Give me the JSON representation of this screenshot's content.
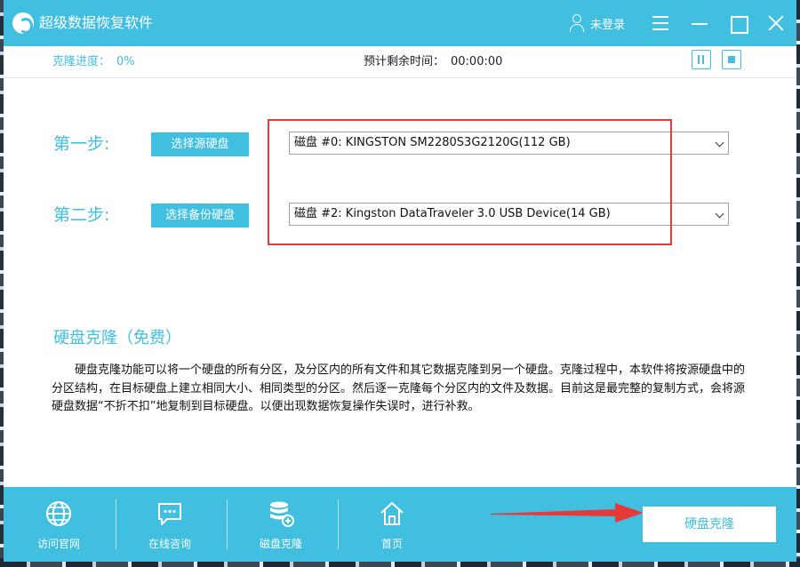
{
  "app": {
    "title": "超级数据恢复软件"
  },
  "titlebar": {
    "user_label": "未登录"
  },
  "progress": {
    "label": "克隆进度：",
    "value": "0%",
    "eta_label": "预计剩余时间：",
    "eta_value": "00:00:00"
  },
  "steps": [
    {
      "label": "第一步:",
      "button": "选择源硬盘",
      "selected": "磁盘 #0: KINGSTON SM2280S3G2120G(112 GB)"
    },
    {
      "label": "第二步:",
      "button": "选择备份硬盘",
      "selected": "磁盘 #2: Kingston DataTraveler 3.0 USB Device(14 GB)"
    }
  ],
  "info": {
    "title": "硬盘克隆（免费）",
    "text": "硬盘克隆功能可以将一个硬盘的所有分区，及分区内的所有文件和其它数据克隆到另一个硬盘。克隆过程中，本软件将按源硬盘中的分区结构，在目标硬盘上建立相同大小、相同类型的分区。然后逐一克隆每个分区内的文件及数据。目前这是最完整的复制方式，会将源硬盘数据“不折不扣”地复制到目标硬盘。以便出现数据恢复操作失误时，进行补救。"
  },
  "footer": {
    "nav": [
      {
        "label": "访问官网",
        "icon": "globe-icon"
      },
      {
        "label": "在线咨询",
        "icon": "chat-icon"
      },
      {
        "label": "磁盘克隆",
        "icon": "disk-stack-icon"
      },
      {
        "label": "首页",
        "icon": "home-icon"
      }
    ],
    "action_label": "硬盘克隆"
  },
  "colors": {
    "accent": "#41bfe0",
    "highlight": "#e63a3a"
  }
}
